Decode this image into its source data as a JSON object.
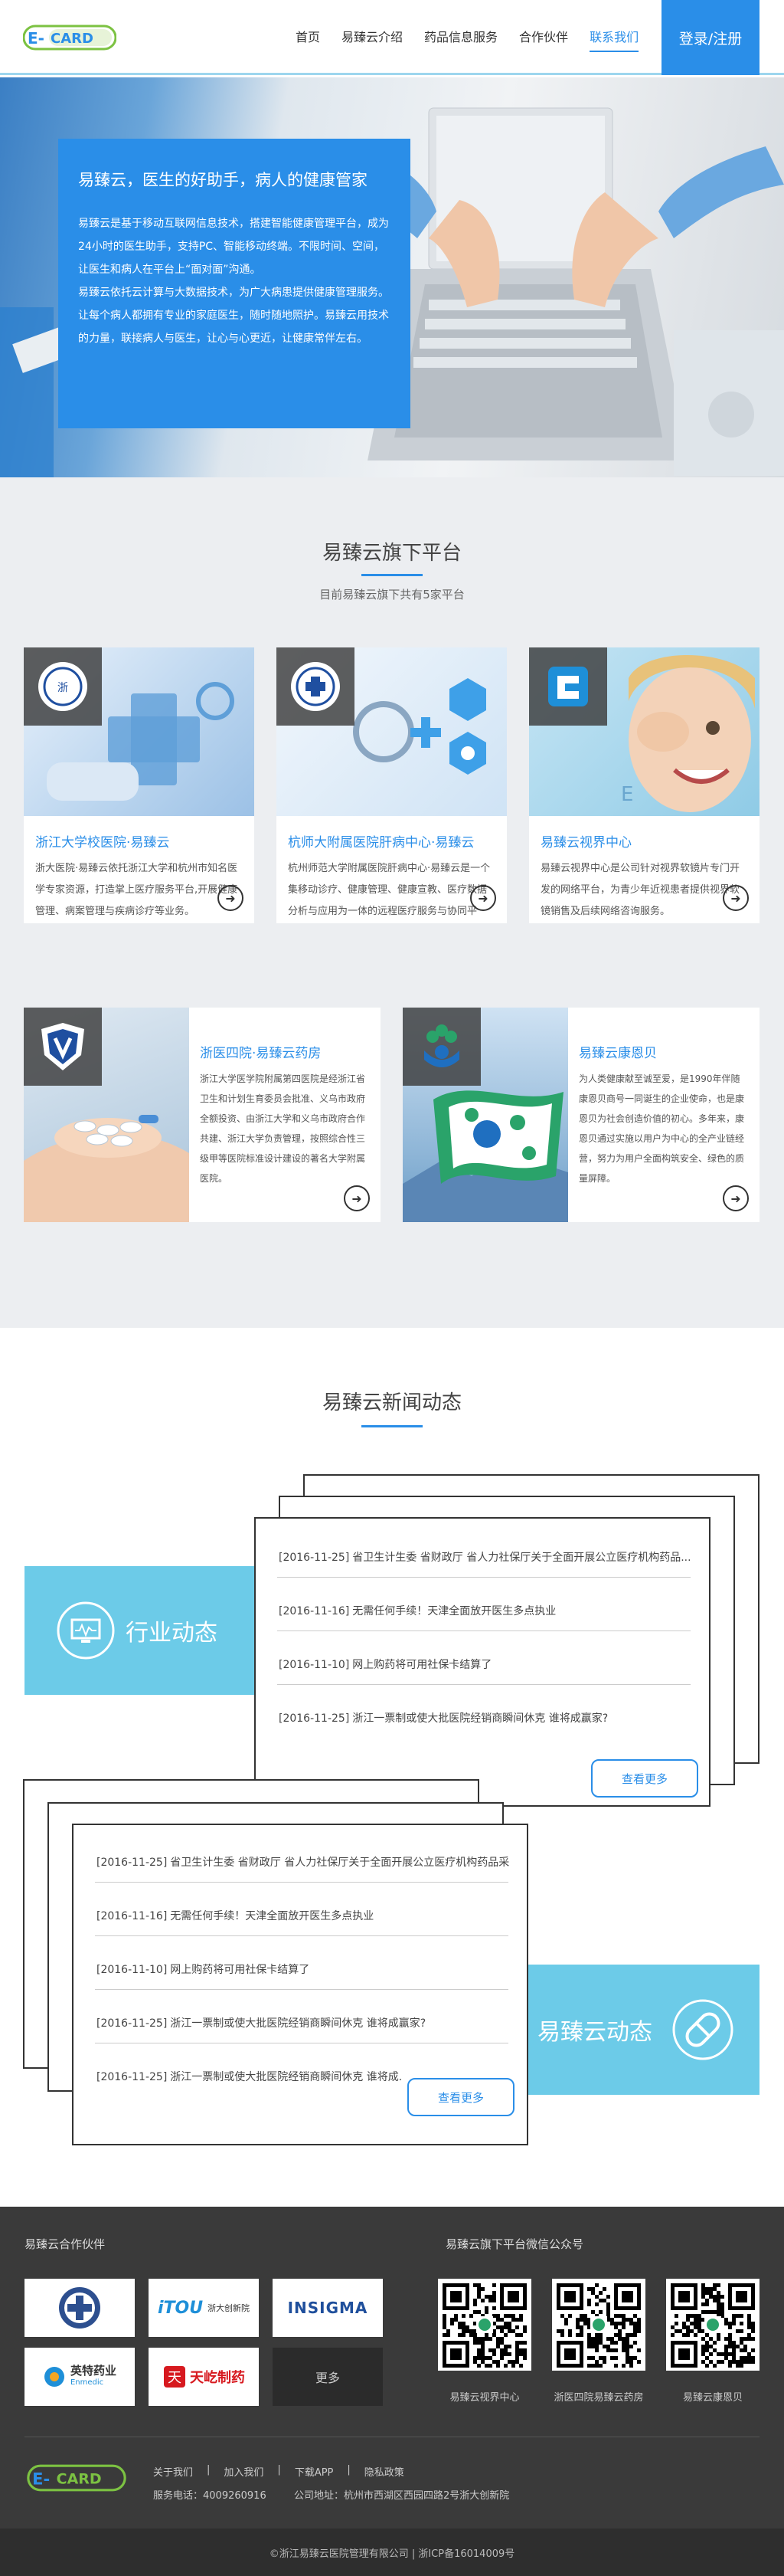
{
  "brand": {
    "logo_text": "E-CARD",
    "primary": "#2a8ee8",
    "accent": "#6ccbe8",
    "green": "#7cc242"
  },
  "nav": {
    "items": [
      "首页",
      "易臻云介绍",
      "药品信息服务",
      "合作伙伴",
      "联系我们"
    ],
    "active_index": 4,
    "login": "登录/注册"
  },
  "hero": {
    "title": "易臻云，医生的好助手，病人的健康管家",
    "paragraph1": "易臻云是基于移动互联网信息技术，搭建智能健康管理平台，成为24小时的医生助手，支持PC、智能移动终端。不限时间、空间，让医生和病人在平台上“面对面”沟通。",
    "paragraph2": "易臻云依托云计算与大数据技术，为广大病患提供健康管理服务。让每个病人都拥有专业的家庭医生，随时随地照护。易臻云用技术的力量，联接病人与医生，让心与心更近，让健康常伴左右。"
  },
  "platforms": {
    "title": "易臻云旗下平台",
    "subtitle": "目前易臻云旗下共有5家平台",
    "cards": [
      {
        "title": "浙江大学校医院·易臻云",
        "text": "浙大医院·易臻云依托浙江大学和杭州市知名医学专家资源，打造掌上医疗服务平台,开展健康管理、病案管理与疾病诊疗等业务。"
      },
      {
        "title": "杭师大附属医院肝病中心·易臻云",
        "text": "杭州师范大学附属医院肝病中心·易臻云是一个集移动诊疗、健康管理、健康宣教、医疗数据分析与应用为一体的远程医疗服务与协同平台。"
      },
      {
        "title": "易臻云视界中心",
        "text": "易臻云视界中心是公司针对视界软镜片专门开发的网络平台，为青少年近视患者提供视界软镜销售及后续网络咨询服务。"
      },
      {
        "title": "浙医四院·易臻云药房",
        "text": "浙江大学医学院附属第四医院是经浙江省卫生和计划生育委员会批准、义乌市政府全额投资、由浙江大学和义乌市政府合作共建、浙江大学负责管理，按照综合性三级甲等医院标准设计建设的著名大学附属医院。"
      },
      {
        "title": "易臻云康恩贝",
        "text": "为人类健康献至诚至爱，是1990年伴随康恩贝商号一同诞生的企业使命，也是康恩贝为社会创造价值的初心。多年来，康恩贝通过实施以用户为中心的全产业链经营，努力为用户全面构筑安全、绿色的质量屏障。"
      }
    ]
  },
  "news": {
    "title": "易臻云新闻动态",
    "industry": {
      "label": "行业动态",
      "items": [
        {
          "date": "[2016-11-25]",
          "text": "省卫生计生委 省财政厅 省人力社保厅关于全面开展公立医疗机构药品..."
        },
        {
          "date": "[2016-11-16]",
          "text": "无需任何手续！天津全面放开医生多点执业"
        },
        {
          "date": "[2016-11-10]",
          "text": "网上购药将可用社保卡结算了"
        },
        {
          "date": "[2016-11-25]",
          "text": "浙江一票制或使大批医院经销商瞬间休克 谁将成赢家?"
        }
      ],
      "more": "查看更多"
    },
    "company": {
      "label": "易臻云动态",
      "items": [
        {
          "date": "[2016-11-25]",
          "text": "省卫生计生委 省财政厅 省人力社保厅关于全面开展公立医疗机构药品采..."
        },
        {
          "date": "[2016-11-16]",
          "text": "无需任何手续！天津全面放开医生多点执业"
        },
        {
          "date": "[2016-11-10]",
          "text": "网上购药将可用社保卡结算了"
        },
        {
          "date": "[2016-11-25]",
          "text": "浙江一票制或使大批医院经销商瞬间休克 谁将成赢家?"
        },
        {
          "date": "[2016-11-25]",
          "text": "浙江一票制或使大批医院经销商瞬间休克 谁将成..."
        }
      ],
      "more": "查看更多"
    }
  },
  "footer": {
    "partners_title": "易臻云合作伙伴",
    "partners": [
      {
        "name": "",
        "mark": "✚"
      },
      {
        "name": "浙大创新院",
        "mark": "iTOU"
      },
      {
        "name": "",
        "mark": "INSIGMA"
      },
      {
        "name": "英特药业",
        "mark": "Enmedic"
      },
      {
        "name": "天屹制药",
        "mark": ""
      }
    ],
    "more": "更多",
    "wechat_title": "易臻云旗下平台微信公众号",
    "qr_labels": [
      "易臻云视界中心",
      "浙医四院易臻云药房",
      "易臻云康恩贝"
    ],
    "links": [
      "关于我们",
      "加入我们",
      "下载APP",
      "隐私政策"
    ],
    "phone": "服务电话：4009260916",
    "address": "公司地址：杭州市西湖区西园四路2号浙大创新院",
    "copyright": "©浙江易臻云医院管理有限公司 | 浙ICP备16014009号"
  }
}
